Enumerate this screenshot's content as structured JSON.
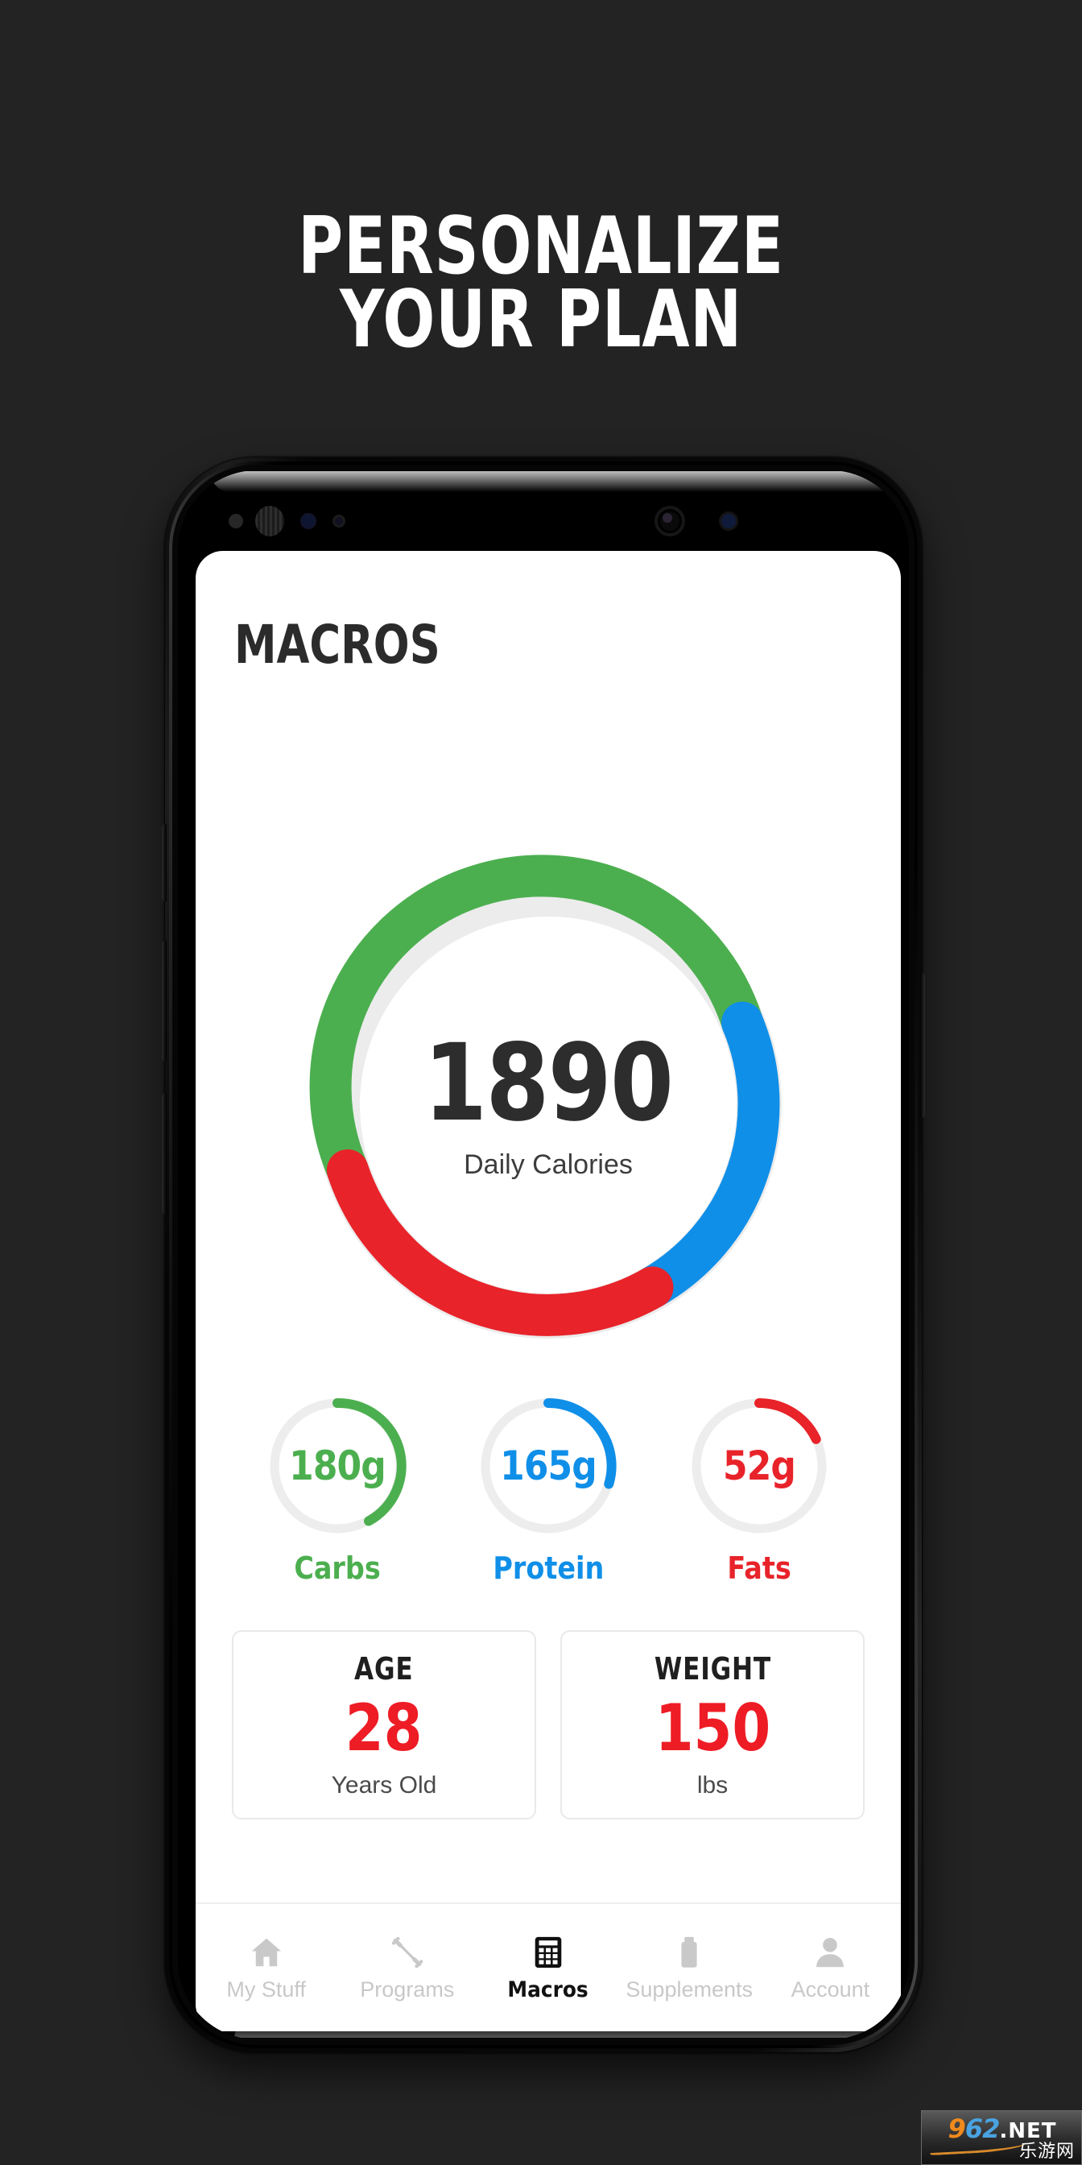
{
  "promo": {
    "line1": "PERSONALIZE",
    "line2": "YOUR PLAN"
  },
  "app": {
    "title": "MACROS"
  },
  "calories": {
    "value": "1890",
    "label": "Daily Calories"
  },
  "macros": [
    {
      "value": "180g",
      "label": "Carbs",
      "color": "#4caf4f",
      "icon": "ring-progress-icon",
      "percent": 45
    },
    {
      "value": "165g",
      "label": "Protein",
      "color": "#108fe8",
      "icon": "ring-progress-icon",
      "percent": 29
    },
    {
      "value": "52g",
      "label": "Fats",
      "color": "#e8232a",
      "icon": "ring-progress-icon",
      "percent": 18
    }
  ],
  "stats": [
    {
      "title": "AGE",
      "value": "28",
      "unit": "Years Old"
    },
    {
      "title": "WEIGHT",
      "value": "150",
      "unit": "lbs"
    }
  ],
  "nav": [
    {
      "label": "My Stuff",
      "icon": "home-icon",
      "active": false
    },
    {
      "label": "Programs",
      "icon": "dumbbell-icon",
      "active": false
    },
    {
      "label": "Macros",
      "icon": "calculator-icon",
      "active": true
    },
    {
      "label": "Supplements",
      "icon": "bottle-icon",
      "active": false
    },
    {
      "label": "Account",
      "icon": "person-icon",
      "active": false
    }
  ],
  "watermark": {
    "num1": "9",
    "num2": "62",
    "net": ".NET",
    "cn": "乐游网"
  },
  "colors": {
    "carbs": "#4caf4f",
    "protein": "#108fe8",
    "fats": "#e8232a",
    "accent_red": "#ee1c25",
    "track": "#e8e8e8",
    "background": "#232323"
  },
  "chart_data": {
    "type": "pie",
    "title": "Daily Calories macro split",
    "center_value": "1890",
    "center_label": "Daily Calories",
    "categories": [
      "Carbs",
      "Protein",
      "Fats"
    ],
    "values": [
      180,
      165,
      52
    ],
    "units": "g",
    "colors": [
      "#4caf4f",
      "#108fe8",
      "#e8232a"
    ],
    "arc_degrees": [
      185,
      97,
      78
    ],
    "start_angle_deg": -72,
    "grid": false,
    "legend": "below-as-mini-rings",
    "mini_rings": [
      {
        "name": "Carbs",
        "value": 180,
        "sweep_deg": 160,
        "color": "#4caf4f"
      },
      {
        "name": "Protein",
        "value": 165,
        "sweep_deg": 105,
        "color": "#108fe8"
      },
      {
        "name": "Fats",
        "value": 52,
        "sweep_deg": 65,
        "color": "#e8232a"
      }
    ]
  }
}
